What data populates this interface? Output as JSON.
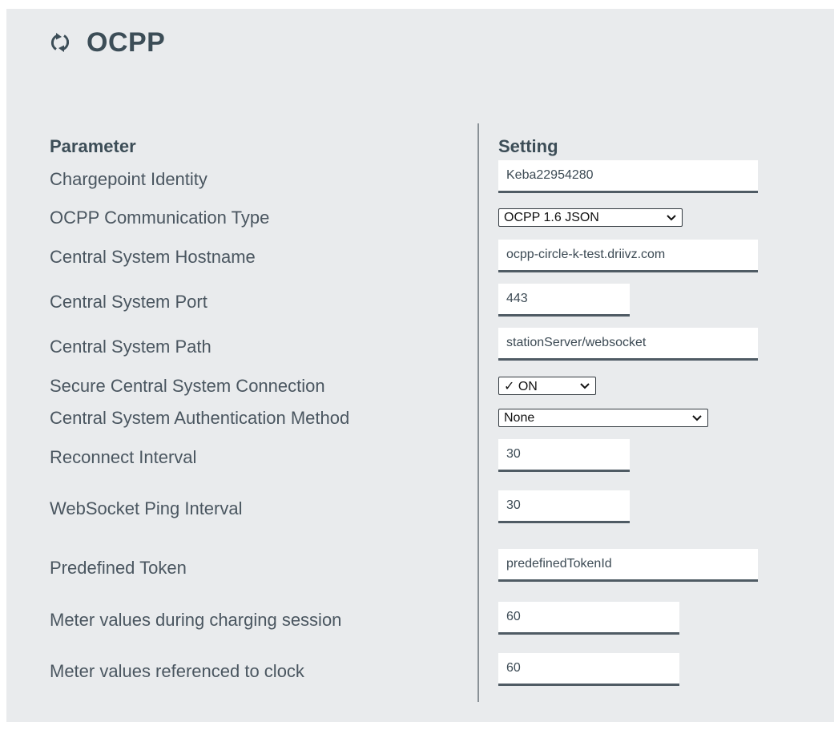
{
  "header": {
    "title": "OCPP",
    "icon": "sync-icon"
  },
  "table": {
    "param_header": "Parameter",
    "setting_header": "Setting",
    "rows": [
      {
        "label": "Chargepoint Identity",
        "value": "Keba22954280"
      },
      {
        "label": "OCPP Communication Type",
        "value": "OCPP 1.6 JSON"
      },
      {
        "label": "Central System Hostname",
        "value": "ocpp-circle-k-test.driivz.com"
      },
      {
        "label": "Central System Port",
        "value": "443"
      },
      {
        "label": "Central System Path",
        "value": "stationServer/websocket"
      },
      {
        "label": "Secure Central System Connection",
        "value": "✓ ON"
      },
      {
        "label": "Central System Authentication Method",
        "value": "None"
      },
      {
        "label": "Reconnect Interval",
        "value": "30"
      },
      {
        "label": "WebSocket Ping Interval",
        "value": "30"
      },
      {
        "label": "Predefined Token",
        "value": "predefinedTokenId"
      },
      {
        "label": "Meter values during charging session",
        "value": "60"
      },
      {
        "label": "Meter values referenced to clock",
        "value": "60"
      }
    ]
  }
}
